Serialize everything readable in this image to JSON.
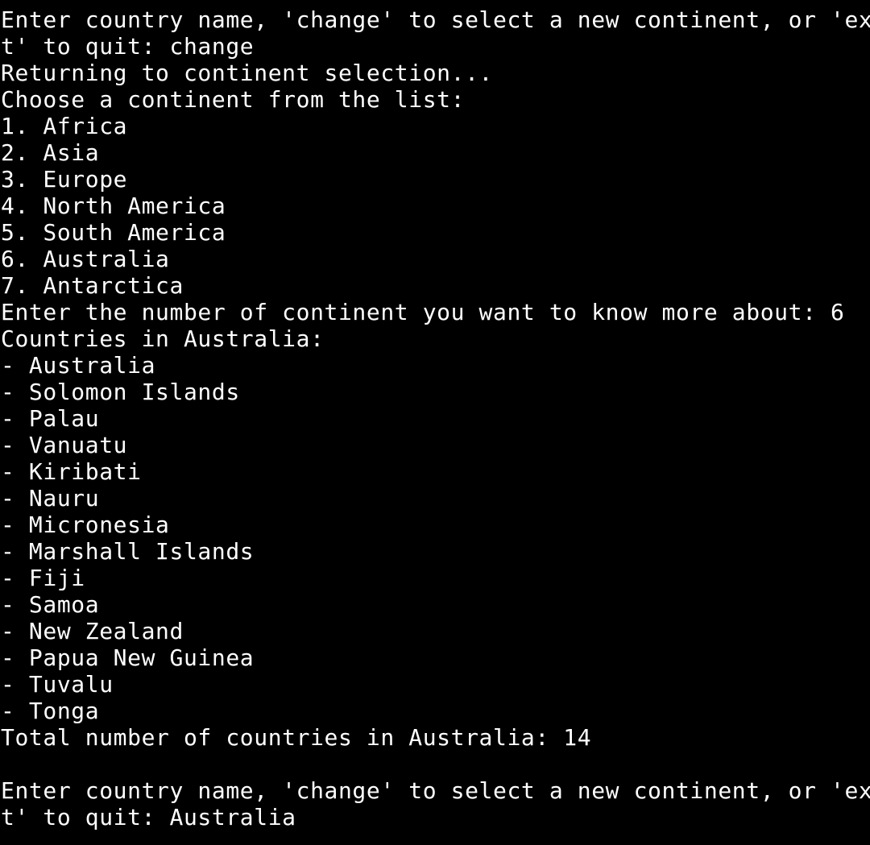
{
  "colors": {
    "background": "#000000",
    "text": "#ffffff"
  },
  "terminal": {
    "lines": [
      "Enter country name, 'change' to select a new continent, or 'exi",
      "t' to quit: change",
      "Returning to continent selection...",
      "Choose a continent from the list:",
      "1. Africa",
      "2. Asia",
      "3. Europe",
      "4. North America",
      "5. South America",
      "6. Australia",
      "7. Antarctica",
      "Enter the number of continent you want to know more about: 6",
      "Countries in Australia:",
      "- Australia",
      "- Solomon Islands",
      "- Palau",
      "- Vanuatu",
      "- Kiribati",
      "- Nauru",
      "- Micronesia",
      "- Marshall Islands",
      "- Fiji",
      "- Samoa",
      "- New Zealand",
      "- Papua New Guinea",
      "- Tuvalu",
      "- Tonga",
      "Total number of countries in Australia: 14",
      "",
      "Enter country name, 'change' to select a new continent, or 'exi",
      "t' to quit: Australia"
    ]
  }
}
